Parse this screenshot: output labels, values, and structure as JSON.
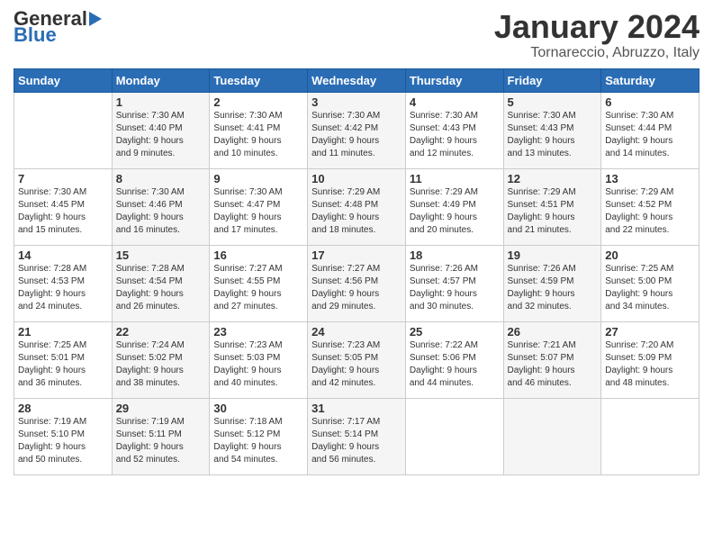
{
  "header": {
    "logo_general": "General",
    "logo_blue": "Blue",
    "month_title": "January 2024",
    "location": "Tornareccio, Abruzzo, Italy"
  },
  "days_of_week": [
    "Sunday",
    "Monday",
    "Tuesday",
    "Wednesday",
    "Thursday",
    "Friday",
    "Saturday"
  ],
  "weeks": [
    [
      {
        "day": "",
        "info": ""
      },
      {
        "day": "1",
        "info": "Sunrise: 7:30 AM\nSunset: 4:40 PM\nDaylight: 9 hours\nand 9 minutes."
      },
      {
        "day": "2",
        "info": "Sunrise: 7:30 AM\nSunset: 4:41 PM\nDaylight: 9 hours\nand 10 minutes."
      },
      {
        "day": "3",
        "info": "Sunrise: 7:30 AM\nSunset: 4:42 PM\nDaylight: 9 hours\nand 11 minutes."
      },
      {
        "day": "4",
        "info": "Sunrise: 7:30 AM\nSunset: 4:43 PM\nDaylight: 9 hours\nand 12 minutes."
      },
      {
        "day": "5",
        "info": "Sunrise: 7:30 AM\nSunset: 4:43 PM\nDaylight: 9 hours\nand 13 minutes."
      },
      {
        "day": "6",
        "info": "Sunrise: 7:30 AM\nSunset: 4:44 PM\nDaylight: 9 hours\nand 14 minutes."
      }
    ],
    [
      {
        "day": "7",
        "info": "Sunrise: 7:30 AM\nSunset: 4:45 PM\nDaylight: 9 hours\nand 15 minutes."
      },
      {
        "day": "8",
        "info": "Sunrise: 7:30 AM\nSunset: 4:46 PM\nDaylight: 9 hours\nand 16 minutes."
      },
      {
        "day": "9",
        "info": "Sunrise: 7:30 AM\nSunset: 4:47 PM\nDaylight: 9 hours\nand 17 minutes."
      },
      {
        "day": "10",
        "info": "Sunrise: 7:29 AM\nSunset: 4:48 PM\nDaylight: 9 hours\nand 18 minutes."
      },
      {
        "day": "11",
        "info": "Sunrise: 7:29 AM\nSunset: 4:49 PM\nDaylight: 9 hours\nand 20 minutes."
      },
      {
        "day": "12",
        "info": "Sunrise: 7:29 AM\nSunset: 4:51 PM\nDaylight: 9 hours\nand 21 minutes."
      },
      {
        "day": "13",
        "info": "Sunrise: 7:29 AM\nSunset: 4:52 PM\nDaylight: 9 hours\nand 22 minutes."
      }
    ],
    [
      {
        "day": "14",
        "info": "Sunrise: 7:28 AM\nSunset: 4:53 PM\nDaylight: 9 hours\nand 24 minutes."
      },
      {
        "day": "15",
        "info": "Sunrise: 7:28 AM\nSunset: 4:54 PM\nDaylight: 9 hours\nand 26 minutes."
      },
      {
        "day": "16",
        "info": "Sunrise: 7:27 AM\nSunset: 4:55 PM\nDaylight: 9 hours\nand 27 minutes."
      },
      {
        "day": "17",
        "info": "Sunrise: 7:27 AM\nSunset: 4:56 PM\nDaylight: 9 hours\nand 29 minutes."
      },
      {
        "day": "18",
        "info": "Sunrise: 7:26 AM\nSunset: 4:57 PM\nDaylight: 9 hours\nand 30 minutes."
      },
      {
        "day": "19",
        "info": "Sunrise: 7:26 AM\nSunset: 4:59 PM\nDaylight: 9 hours\nand 32 minutes."
      },
      {
        "day": "20",
        "info": "Sunrise: 7:25 AM\nSunset: 5:00 PM\nDaylight: 9 hours\nand 34 minutes."
      }
    ],
    [
      {
        "day": "21",
        "info": "Sunrise: 7:25 AM\nSunset: 5:01 PM\nDaylight: 9 hours\nand 36 minutes."
      },
      {
        "day": "22",
        "info": "Sunrise: 7:24 AM\nSunset: 5:02 PM\nDaylight: 9 hours\nand 38 minutes."
      },
      {
        "day": "23",
        "info": "Sunrise: 7:23 AM\nSunset: 5:03 PM\nDaylight: 9 hours\nand 40 minutes."
      },
      {
        "day": "24",
        "info": "Sunrise: 7:23 AM\nSunset: 5:05 PM\nDaylight: 9 hours\nand 42 minutes."
      },
      {
        "day": "25",
        "info": "Sunrise: 7:22 AM\nSunset: 5:06 PM\nDaylight: 9 hours\nand 44 minutes."
      },
      {
        "day": "26",
        "info": "Sunrise: 7:21 AM\nSunset: 5:07 PM\nDaylight: 9 hours\nand 46 minutes."
      },
      {
        "day": "27",
        "info": "Sunrise: 7:20 AM\nSunset: 5:09 PM\nDaylight: 9 hours\nand 48 minutes."
      }
    ],
    [
      {
        "day": "28",
        "info": "Sunrise: 7:19 AM\nSunset: 5:10 PM\nDaylight: 9 hours\nand 50 minutes."
      },
      {
        "day": "29",
        "info": "Sunrise: 7:19 AM\nSunset: 5:11 PM\nDaylight: 9 hours\nand 52 minutes."
      },
      {
        "day": "30",
        "info": "Sunrise: 7:18 AM\nSunset: 5:12 PM\nDaylight: 9 hours\nand 54 minutes."
      },
      {
        "day": "31",
        "info": "Sunrise: 7:17 AM\nSunset: 5:14 PM\nDaylight: 9 hours\nand 56 minutes."
      },
      {
        "day": "",
        "info": ""
      },
      {
        "day": "",
        "info": ""
      },
      {
        "day": "",
        "info": ""
      }
    ]
  ]
}
